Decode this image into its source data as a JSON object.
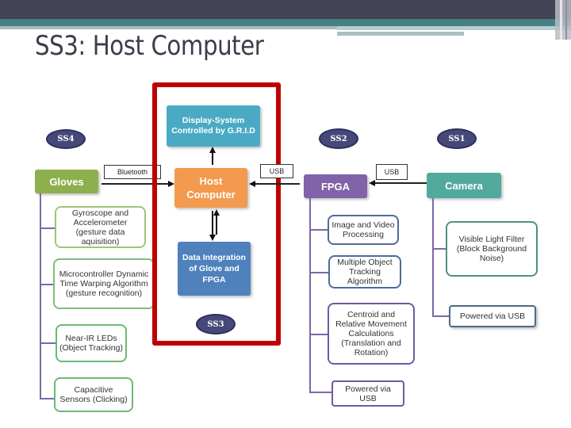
{
  "slide": {
    "title": "SS3: Host Computer"
  },
  "colors": {
    "header_dark": "#424455",
    "header_teal": "#468083",
    "highlight_frame": "#c00000",
    "gloves": "#8db04f",
    "host_computer": "#f39a4e",
    "display_system": "#4aaac4",
    "data_integration": "#4f81bd",
    "fpga": "#8063a8",
    "camera": "#52aa9d",
    "subsystem_badge": "#464878"
  },
  "badges": {
    "ss4": "SS4",
    "ss2": "SS2",
    "ss1": "SS1",
    "ss3": "SS3"
  },
  "host": {
    "display_system": "Display-System Controlled by G.R.I.D",
    "host_computer": "Host Computer",
    "data_integration": "Data Integration of Glove and FPGA"
  },
  "gloves": {
    "title": "Gloves",
    "items": [
      "Gyroscope and Accelerometer (gesture data aquisition)",
      "Microcontroller Dynamic Time Warping Algorithm (gesture recognition)",
      "Near-IR LEDs (Object Tracking)",
      "Capacitive Sensors (Clicking)"
    ]
  },
  "fpga": {
    "title": "FPGA",
    "items": [
      "Image and Video Processing",
      "Multiple Object Tracking Algorithm",
      "Centroid and Relative Movement Calculations (Translation and Rotation)",
      "Powered via USB"
    ]
  },
  "camera": {
    "title": "Camera",
    "items": [
      "Visible Light Filter (Block Background Noise)",
      "Powered via USB"
    ]
  },
  "connections": {
    "gloves_to_host": "Bluetooth",
    "fpga_to_host": "USB",
    "camera_to_fpga": "USB"
  }
}
